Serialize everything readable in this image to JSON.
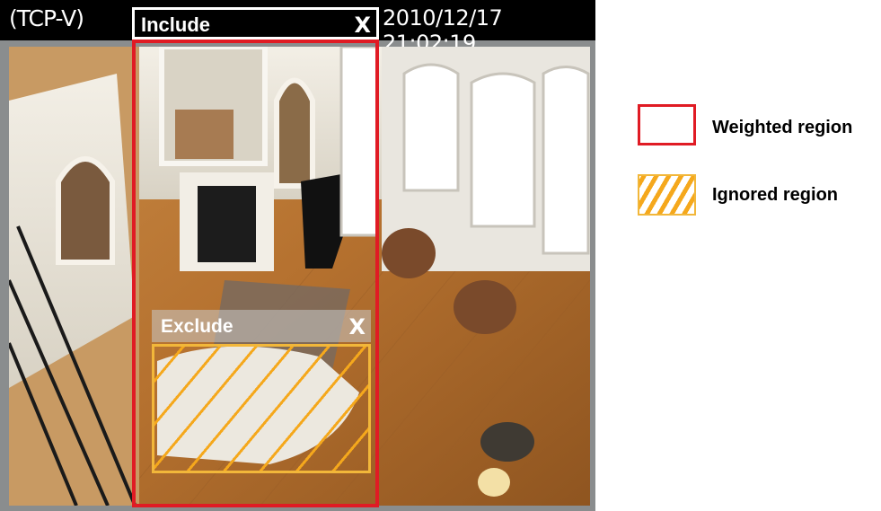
{
  "status_bar": {
    "protocol": "(TCP-V)",
    "timestamp": "2010/12/17 21:02:19"
  },
  "include_window": {
    "title": "Include",
    "close_label": "X"
  },
  "exclude_window": {
    "title": "Exclude",
    "close_label": "X"
  },
  "legend": {
    "weighted_label": "Weighted region",
    "ignored_label": "Ignored region"
  },
  "colors": {
    "weighted_border": "#e01b24",
    "ignored_hatch": "#f5a81c"
  }
}
